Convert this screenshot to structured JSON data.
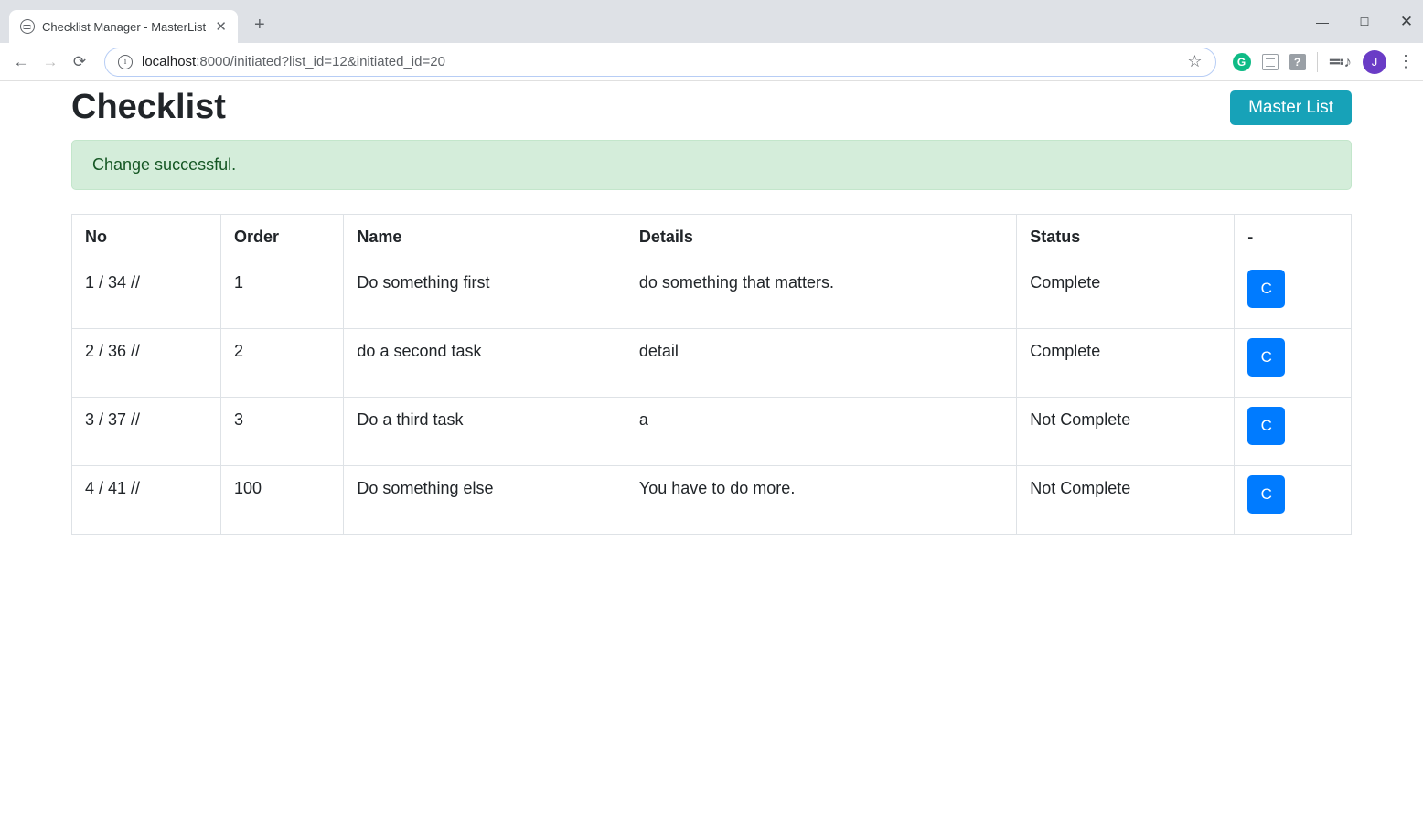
{
  "browser": {
    "tab_title": "Checklist Manager - MasterList",
    "url_host": "localhost",
    "url_port_path": ":8000/initiated?list_id=12&initiated_id=20",
    "avatar_letter": "J",
    "grammarly_letter": "G",
    "question_mark": "?"
  },
  "page": {
    "title": "Checklist",
    "master_list_label": "Master List",
    "alert": "Change successful."
  },
  "table": {
    "headers": {
      "no": "No",
      "order": "Order",
      "name": "Name",
      "details": "Details",
      "status": "Status",
      "actions": "-"
    },
    "rows": [
      {
        "no": "1 / 34 //",
        "order": "1",
        "name": "Do something first",
        "details": "do something that matters.",
        "status": "Complete",
        "action": "C"
      },
      {
        "no": "2 / 36 //",
        "order": "2",
        "name": "do a second task",
        "details": "detail",
        "status": "Complete",
        "action": "C"
      },
      {
        "no": "3 / 37 //",
        "order": "3",
        "name": "Do a third task",
        "details": "a",
        "status": "Not Complete",
        "action": "C"
      },
      {
        "no": "4 / 41 //",
        "order": "100",
        "name": "Do something else",
        "details": "You have to do more.",
        "status": "Not Complete",
        "action": "C"
      }
    ]
  }
}
